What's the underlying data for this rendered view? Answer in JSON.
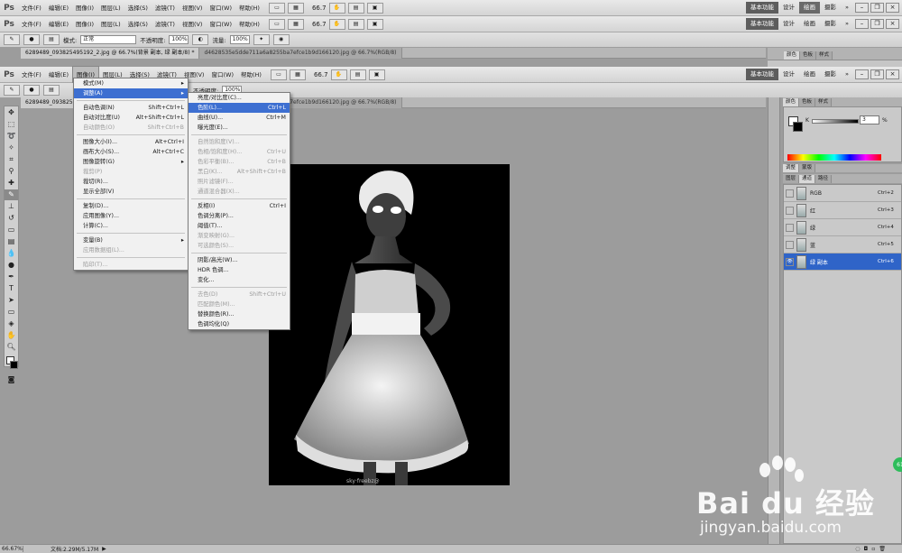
{
  "app": {
    "logo": "Ps",
    "zoom_value": "66.7"
  },
  "menubar": {
    "items": [
      "文件(F)",
      "编辑(E)",
      "图像(I)",
      "图层(L)",
      "选择(S)",
      "滤镜(T)",
      "视图(V)",
      "窗口(W)",
      "帮助(H)"
    ]
  },
  "workspace": {
    "essentials": "基本功能",
    "design": "设计",
    "painting": "绘画",
    "photo": "摄影"
  },
  "options_bar": {
    "mode_label": "模式:",
    "mode_value": "正常",
    "opacity_label": "不透明度:",
    "opacity_value": "100%",
    "flow_label": "流量:",
    "flow_value": "100%"
  },
  "doc_tabs_top": [
    "6289489_093825495192_2.jpg @ 66.7%(背景 副本, 绿 副本/8) *",
    "d4628535e5dde711a6a8255ba7efce1b9d166120.jpg @ 66.7%(RGB/8)"
  ],
  "doc_tabs_bottom": [
    "6289489_093825495192_2.jpg @ 66.7%(背景 副本, 绿 副本/8) *",
    "d4628535e5dde711a6a8255ba7efce1b9d166120.jpg @ 66.7%(RGB/8)"
  ],
  "canvas_watermark": "sky·freebz@",
  "image_menu": [
    {
      "label": "模式(M)",
      "sc": "",
      "sub": true
    },
    {
      "label": "调整(A)",
      "sc": "",
      "sub": true,
      "hl": true
    },
    {
      "sep": true
    },
    {
      "label": "自动色调(N)",
      "sc": "Shift+Ctrl+L"
    },
    {
      "label": "自动对比度(U)",
      "sc": "Alt+Shift+Ctrl+L"
    },
    {
      "label": "自动颜色(O)",
      "sc": "Shift+Ctrl+B",
      "dis": true
    },
    {
      "sep": true
    },
    {
      "label": "图像大小(I)...",
      "sc": "Alt+Ctrl+I"
    },
    {
      "label": "画布大小(S)...",
      "sc": "Alt+Ctrl+C"
    },
    {
      "label": "图像旋转(G)",
      "sc": "",
      "sub": true
    },
    {
      "label": "裁剪(P)",
      "sc": "",
      "dis": true
    },
    {
      "label": "裁切(R)...",
      "sc": ""
    },
    {
      "label": "显示全部(V)",
      "sc": ""
    },
    {
      "sep": true
    },
    {
      "label": "复制(D)...",
      "sc": ""
    },
    {
      "label": "应用图像(Y)...",
      "sc": ""
    },
    {
      "label": "计算(C)...",
      "sc": ""
    },
    {
      "sep": true
    },
    {
      "label": "变量(B)",
      "sc": "",
      "sub": true
    },
    {
      "label": "应用数据组(L)...",
      "sc": "",
      "dis": true
    },
    {
      "sep": true
    },
    {
      "label": "陷印(T)...",
      "sc": "",
      "dis": true
    }
  ],
  "adjust_menu": [
    {
      "label": "亮度/对比度(C)...",
      "sc": ""
    },
    {
      "label": "色阶(L)...",
      "sc": "Ctrl+L",
      "hl": true
    },
    {
      "label": "曲线(U)...",
      "sc": "Ctrl+M"
    },
    {
      "label": "曝光度(E)...",
      "sc": ""
    },
    {
      "sep": true
    },
    {
      "label": "自然饱和度(V)...",
      "sc": "",
      "dis": true
    },
    {
      "label": "色相/饱和度(H)...",
      "sc": "Ctrl+U",
      "dis": true
    },
    {
      "label": "色彩平衡(B)...",
      "sc": "Ctrl+B",
      "dis": true
    },
    {
      "label": "黑白(K)...",
      "sc": "Alt+Shift+Ctrl+B",
      "dis": true
    },
    {
      "label": "照片滤镜(F)...",
      "sc": "",
      "dis": true
    },
    {
      "label": "通道混合器(X)...",
      "sc": "",
      "dis": true
    },
    {
      "sep": true
    },
    {
      "label": "反相(I)",
      "sc": "Ctrl+I"
    },
    {
      "label": "色调分离(P)...",
      "sc": ""
    },
    {
      "label": "阈值(T)...",
      "sc": ""
    },
    {
      "label": "渐变映射(G)...",
      "sc": "",
      "dis": true
    },
    {
      "label": "可选颜色(S)...",
      "sc": "",
      "dis": true
    },
    {
      "sep": true
    },
    {
      "label": "阴影/高光(W)...",
      "sc": ""
    },
    {
      "label": "HDR 色调...",
      "sc": ""
    },
    {
      "label": "变化...",
      "sc": ""
    },
    {
      "sep": true
    },
    {
      "label": "去色(D)",
      "sc": "Shift+Ctrl+U",
      "dis": true
    },
    {
      "label": "匹配颜色(M)...",
      "sc": "",
      "dis": true
    },
    {
      "label": "替换颜色(R)...",
      "sc": ""
    },
    {
      "label": "色调均化(Q)",
      "sc": ""
    }
  ],
  "color_panel": {
    "tabs": [
      "颜色",
      "色板",
      "样式"
    ],
    "k_label": "K",
    "k_value": "3",
    "percent": "%"
  },
  "adjust_panel": {
    "tabs": [
      "调整",
      "蒙版"
    ]
  },
  "channels_panel": {
    "tabs": [
      "图层",
      "通道",
      "路径"
    ],
    "rows": [
      {
        "name": "RGB",
        "sc": "Ctrl+2"
      },
      {
        "name": "红",
        "sc": "Ctrl+3"
      },
      {
        "name": "绿",
        "sc": "Ctrl+4"
      },
      {
        "name": "蓝",
        "sc": "Ctrl+5"
      },
      {
        "name": "绿 副本",
        "sc": "Ctrl+6",
        "sel": true
      }
    ]
  },
  "status": {
    "zoom": "66.67%",
    "doc_label": "文档:2.29M/5.17M"
  },
  "baidu": {
    "logo": "Bai du 经验",
    "url": "jingyan.baidu.com"
  },
  "colors": {
    "highlight": "#3d6fd1",
    "workspace_active": "#5d5d5d",
    "badge": "#2ebd5b"
  }
}
